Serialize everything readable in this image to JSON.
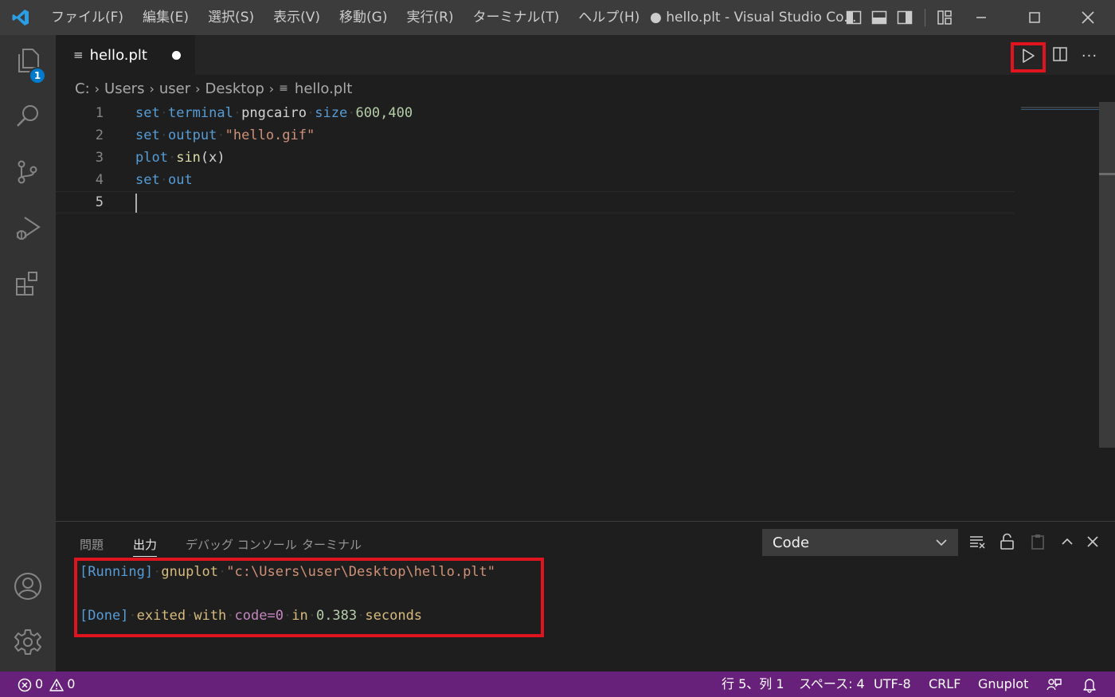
{
  "titlebar": {
    "menu": [
      "ファイル(F)",
      "編集(E)",
      "選択(S)",
      "表示(V)",
      "移動(G)",
      "実行(R)",
      "ターミナル(T)",
      "ヘルプ(H)"
    ],
    "title": "● hello.plt - Visual Studio Co..."
  },
  "activity": {
    "explorer_badge": "1"
  },
  "tab": {
    "name": "hello.plt"
  },
  "breadcrumb": [
    "C:",
    "Users",
    "user",
    "Desktop",
    "hello.plt"
  ],
  "editor": {
    "lines": [
      {
        "num": "1",
        "tokens": [
          "set",
          "terminal",
          "pngcairo",
          "size",
          "600,400"
        ]
      },
      {
        "num": "2",
        "tokens": [
          "set",
          "output",
          "\"hello.gif\""
        ]
      },
      {
        "num": "3",
        "tokens": [
          "plot",
          "sin",
          "(x)"
        ]
      },
      {
        "num": "4",
        "tokens": [
          "set",
          "out"
        ]
      },
      {
        "num": "5",
        "tokens": []
      }
    ]
  },
  "panel": {
    "tabs": [
      "問題",
      "出力",
      "デバッグ コンソール",
      "ターミナル"
    ],
    "output_channel": "Code",
    "output": {
      "line1": {
        "tag": "[Running]",
        "cmd": "gnuplot",
        "path": "\"c:\\Users\\user\\Desktop\\hello.plt\""
      },
      "line2": {
        "tag": "[Done]",
        "w1": "exited",
        "w2": "with",
        "code": "code=0",
        "w3": "in",
        "time": "0.383",
        "w4": "seconds"
      }
    }
  },
  "statusbar": {
    "errors": "0",
    "warnings": "0",
    "position": "行 5、列 1",
    "spaces": "スペース: 4",
    "encoding": "UTF-8",
    "eol": "CRLF",
    "language": "Gnuplot"
  },
  "colors": {
    "accent": "#007acc",
    "statusbar": "#68217a",
    "highlight": "#e0141e"
  }
}
